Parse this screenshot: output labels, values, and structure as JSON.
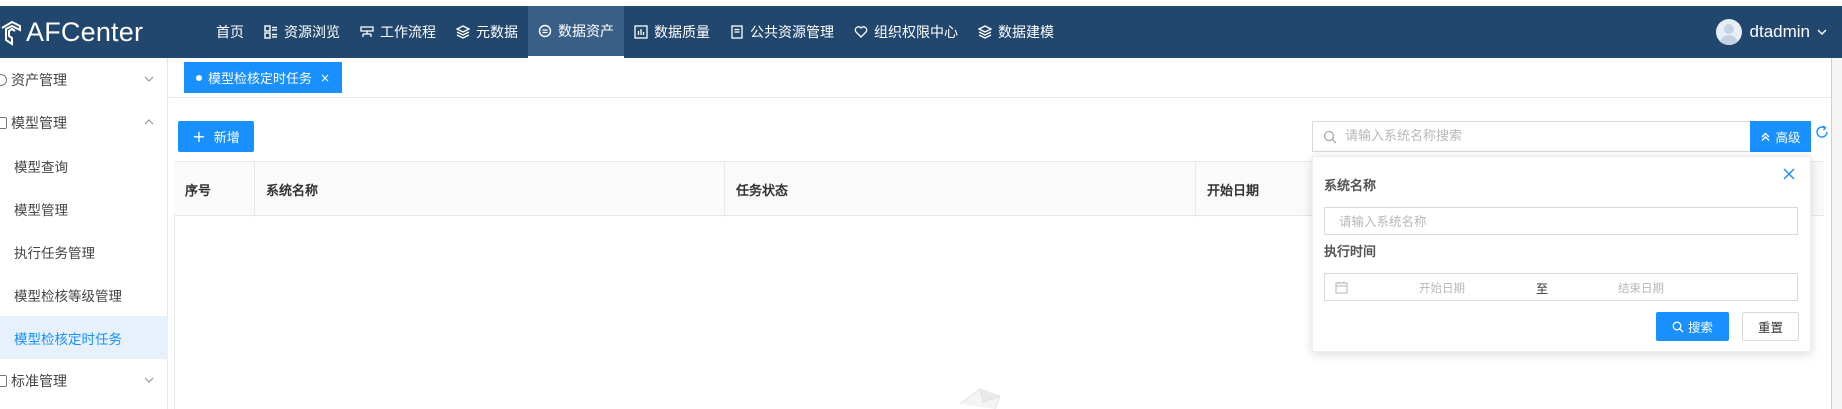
{
  "app": {
    "title": "AFCenter"
  },
  "nav": {
    "items": [
      {
        "label": "首页",
        "icon": ""
      },
      {
        "label": "资源浏览",
        "icon": "grid-list-icon"
      },
      {
        "label": "工作流程",
        "icon": "flow-icon"
      },
      {
        "label": "元数据",
        "icon": "layers-icon"
      },
      {
        "label": "数据资产",
        "icon": "database-icon",
        "active": true
      },
      {
        "label": "数据质量",
        "icon": "chart-icon"
      },
      {
        "label": "公共资源管理",
        "icon": "document-icon"
      },
      {
        "label": "组织权限中心",
        "icon": "heart-icon"
      },
      {
        "label": "数据建模",
        "icon": "layers-icon"
      }
    ]
  },
  "user": {
    "name": "dtadmin"
  },
  "sidebar": {
    "items": [
      {
        "label": "资产管理",
        "type": "group",
        "expanded": false
      },
      {
        "label": "模型管理",
        "type": "group",
        "expanded": true
      },
      {
        "label": "模型查询",
        "type": "sub"
      },
      {
        "label": "模型管理",
        "type": "sub"
      },
      {
        "label": "执行任务管理",
        "type": "sub"
      },
      {
        "label": "模型检核等级管理",
        "type": "sub"
      },
      {
        "label": "模型检核定时任务",
        "type": "sub",
        "selected": true
      },
      {
        "label": "标准管理",
        "type": "group",
        "expanded": false
      }
    ]
  },
  "tabs": [
    {
      "label": "模型检核定时任务",
      "close": "×"
    }
  ],
  "toolbar": {
    "add_label": "新增",
    "add_symbol": "+",
    "search_placeholder": "请输入系统名称搜索",
    "advanced_label": "高级"
  },
  "table": {
    "columns": [
      "序号",
      "系统名称",
      "任务状态",
      "开始日期"
    ]
  },
  "advanced_panel": {
    "system_name_label": "系统名称",
    "system_name_placeholder": "请输入系统名称",
    "exec_time_label": "执行时间",
    "start_placeholder": "开始日期",
    "separator": "至",
    "end_placeholder": "结束日期",
    "search_label": "搜索",
    "reset_label": "重置"
  },
  "colors": {
    "topbar": "#22476e",
    "primary": "#1890ff",
    "selected_bg": "#e6f1fc"
  }
}
